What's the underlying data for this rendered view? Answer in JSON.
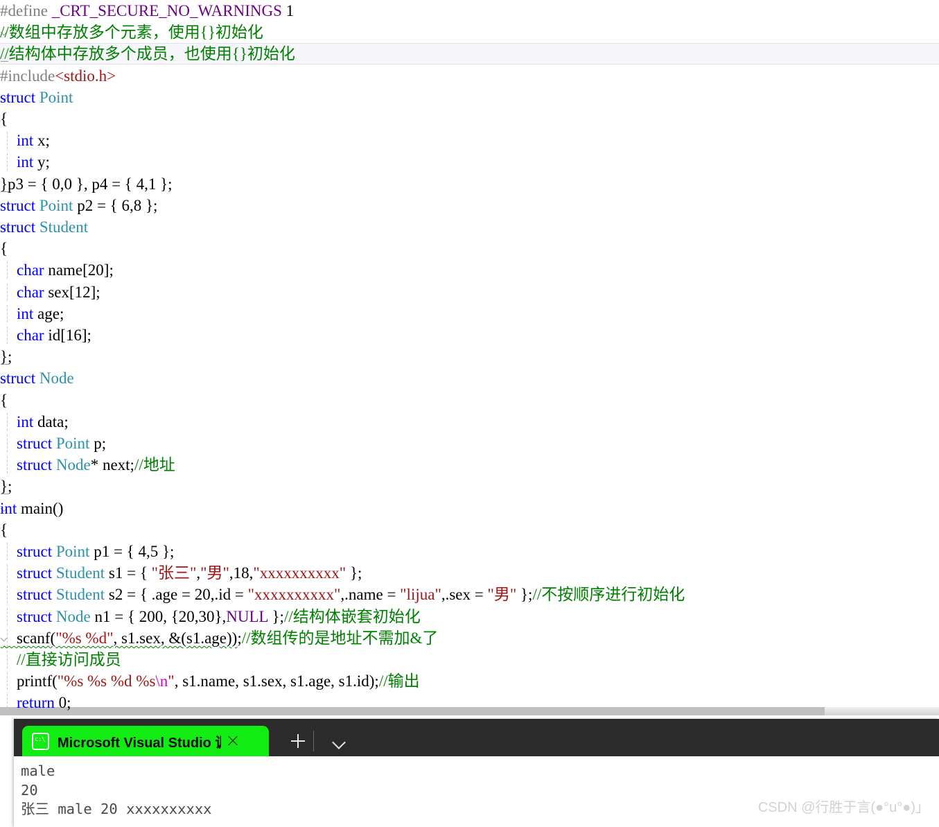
{
  "editor": {
    "lines": [
      {
        "id": "line-define",
        "indent": 0,
        "gutter": "none",
        "tokens": [
          {
            "t": "pp",
            "s": "#define "
          },
          {
            "t": "ppname",
            "s": "_CRT_SECURE_NO_WARNINGS"
          },
          {
            "t": "plain",
            "s": " 1"
          }
        ]
      },
      {
        "id": "line-comment-array",
        "indent": 0,
        "gutter": "arrow",
        "tokens": [
          {
            "t": "cmt",
            "s": "//数组中存放多个元素，使用{}初始化"
          }
        ]
      },
      {
        "id": "line-comment-struct",
        "indent": 0,
        "gutter": "end",
        "current": true,
        "tokens": [
          {
            "t": "cmt",
            "s": "//结构体中存放多个成员，也使用{}初始化"
          }
        ]
      },
      {
        "id": "line-include",
        "indent": 0,
        "gutter": "none",
        "tokens": [
          {
            "t": "pp",
            "s": "#include"
          },
          {
            "t": "hdr",
            "s": "<stdio.h>"
          }
        ]
      },
      {
        "id": "line-struct-point",
        "indent": 0,
        "gutter": "arrow",
        "tokens": [
          {
            "t": "kw",
            "s": "struct"
          },
          {
            "t": "plain",
            "s": " "
          },
          {
            "t": "type",
            "s": "Point"
          }
        ]
      },
      {
        "id": "line-point-open",
        "indent": 0,
        "gutter": "none",
        "tokens": [
          {
            "t": "plain",
            "s": "{"
          }
        ]
      },
      {
        "id": "line-point-x",
        "indent": 1,
        "gutter": "none",
        "guide": true,
        "tokens": [
          {
            "t": "plain",
            "s": "    "
          },
          {
            "t": "kw",
            "s": "int"
          },
          {
            "t": "plain",
            "s": " x;"
          }
        ]
      },
      {
        "id": "line-point-y",
        "indent": 1,
        "gutter": "none",
        "guide": true,
        "tokens": [
          {
            "t": "plain",
            "s": "    "
          },
          {
            "t": "kw",
            "s": "int"
          },
          {
            "t": "plain",
            "s": " y;"
          }
        ]
      },
      {
        "id": "line-point-close",
        "indent": 0,
        "gutter": "end",
        "tokens": [
          {
            "t": "plain",
            "s": "}p3 = { 0,0 }, p4 = { 4,1 };"
          }
        ]
      },
      {
        "id": "line-p2",
        "indent": 0,
        "gutter": "none",
        "tokens": [
          {
            "t": "kw",
            "s": "struct"
          },
          {
            "t": "plain",
            "s": " "
          },
          {
            "t": "type",
            "s": "Point"
          },
          {
            "t": "plain",
            "s": " p2 = { 6,8 };"
          }
        ]
      },
      {
        "id": "line-struct-student",
        "indent": 0,
        "gutter": "arrow",
        "tokens": [
          {
            "t": "kw",
            "s": "struct"
          },
          {
            "t": "plain",
            "s": " "
          },
          {
            "t": "type",
            "s": "Student"
          }
        ]
      },
      {
        "id": "line-student-open",
        "indent": 0,
        "gutter": "none",
        "tokens": [
          {
            "t": "plain",
            "s": "{"
          }
        ]
      },
      {
        "id": "line-student-name",
        "indent": 1,
        "gutter": "none",
        "guide": true,
        "tokens": [
          {
            "t": "plain",
            "s": "    "
          },
          {
            "t": "kw",
            "s": "char"
          },
          {
            "t": "plain",
            "s": " name[20];"
          }
        ]
      },
      {
        "id": "line-student-sex",
        "indent": 1,
        "gutter": "none",
        "guide": true,
        "tokens": [
          {
            "t": "plain",
            "s": "    "
          },
          {
            "t": "kw",
            "s": "char"
          },
          {
            "t": "plain",
            "s": " sex[12];"
          }
        ]
      },
      {
        "id": "line-student-age",
        "indent": 1,
        "gutter": "none",
        "guide": true,
        "tokens": [
          {
            "t": "plain",
            "s": "    "
          },
          {
            "t": "kw",
            "s": "int"
          },
          {
            "t": "plain",
            "s": " age;"
          }
        ]
      },
      {
        "id": "line-student-id",
        "indent": 1,
        "gutter": "none",
        "guide": true,
        "tokens": [
          {
            "t": "plain",
            "s": "    "
          },
          {
            "t": "kw",
            "s": "char"
          },
          {
            "t": "plain",
            "s": " id[16];"
          }
        ]
      },
      {
        "id": "line-student-close",
        "indent": 0,
        "gutter": "end",
        "tokens": [
          {
            "t": "plain",
            "s": "};"
          }
        ]
      },
      {
        "id": "line-struct-node",
        "indent": 0,
        "gutter": "arrow",
        "tokens": [
          {
            "t": "kw",
            "s": "struct"
          },
          {
            "t": "plain",
            "s": " "
          },
          {
            "t": "type",
            "s": "Node"
          }
        ]
      },
      {
        "id": "line-node-open",
        "indent": 0,
        "gutter": "none",
        "tokens": [
          {
            "t": "plain",
            "s": "{"
          }
        ]
      },
      {
        "id": "line-node-data",
        "indent": 1,
        "gutter": "none",
        "guide": true,
        "tokens": [
          {
            "t": "plain",
            "s": "    "
          },
          {
            "t": "kw",
            "s": "int"
          },
          {
            "t": "plain",
            "s": " data;"
          }
        ]
      },
      {
        "id": "line-node-p",
        "indent": 1,
        "gutter": "none",
        "guide": true,
        "tokens": [
          {
            "t": "plain",
            "s": "    "
          },
          {
            "t": "kw",
            "s": "struct"
          },
          {
            "t": "plain",
            "s": " "
          },
          {
            "t": "type",
            "s": "Point"
          },
          {
            "t": "plain",
            "s": " p;"
          }
        ]
      },
      {
        "id": "line-node-next",
        "indent": 1,
        "gutter": "none",
        "guide": true,
        "tokens": [
          {
            "t": "plain",
            "s": "    "
          },
          {
            "t": "kw",
            "s": "struct"
          },
          {
            "t": "plain",
            "s": " "
          },
          {
            "t": "type",
            "s": "Node"
          },
          {
            "t": "plain",
            "s": "* next;"
          },
          {
            "t": "cmt",
            "s": "//地址"
          }
        ]
      },
      {
        "id": "line-node-close",
        "indent": 0,
        "gutter": "end",
        "tokens": [
          {
            "t": "plain",
            "s": "};"
          }
        ]
      },
      {
        "id": "line-main",
        "indent": 0,
        "gutter": "arrow",
        "tokens": [
          {
            "t": "kw",
            "s": "int"
          },
          {
            "t": "plain",
            "s": " "
          },
          {
            "t": "fn",
            "s": "main"
          },
          {
            "t": "plain",
            "s": "()"
          }
        ]
      },
      {
        "id": "line-main-open",
        "indent": 0,
        "gutter": "none",
        "tokens": [
          {
            "t": "plain",
            "s": "{"
          }
        ]
      },
      {
        "id": "line-p1",
        "indent": 1,
        "gutter": "none",
        "guide": true,
        "tokens": [
          {
            "t": "plain",
            "s": "    "
          },
          {
            "t": "kw",
            "s": "struct"
          },
          {
            "t": "plain",
            "s": " "
          },
          {
            "t": "type",
            "s": "Point"
          },
          {
            "t": "plain",
            "s": " p1 = { 4,5 };"
          }
        ]
      },
      {
        "id": "line-s1",
        "indent": 1,
        "gutter": "none",
        "guide": true,
        "tokens": [
          {
            "t": "plain",
            "s": "    "
          },
          {
            "t": "kw",
            "s": "struct"
          },
          {
            "t": "plain",
            "s": " "
          },
          {
            "t": "type",
            "s": "Student"
          },
          {
            "t": "plain",
            "s": " s1 = { "
          },
          {
            "t": "str",
            "s": "\"张三\""
          },
          {
            "t": "plain",
            "s": ","
          },
          {
            "t": "str",
            "s": "\"男\""
          },
          {
            "t": "plain",
            "s": ",18,"
          },
          {
            "t": "str",
            "s": "\"xxxxxxxxxx\""
          },
          {
            "t": "plain",
            "s": " };"
          }
        ]
      },
      {
        "id": "line-s2",
        "indent": 1,
        "gutter": "none",
        "guide": true,
        "tokens": [
          {
            "t": "plain",
            "s": "    "
          },
          {
            "t": "kw",
            "s": "struct"
          },
          {
            "t": "plain",
            "s": " "
          },
          {
            "t": "type",
            "s": "Student"
          },
          {
            "t": "plain",
            "s": " s2 = { .age = 20,.id = "
          },
          {
            "t": "str",
            "s": "\"xxxxxxxxxx\""
          },
          {
            "t": "plain",
            "s": ",.name = "
          },
          {
            "t": "str",
            "s": "\"lijua\""
          },
          {
            "t": "plain",
            "s": ",.sex = "
          },
          {
            "t": "str",
            "s": "\"男\""
          },
          {
            "t": "plain",
            "s": " };"
          },
          {
            "t": "cmt",
            "s": "//不按顺序进行初始化"
          }
        ]
      },
      {
        "id": "line-n1",
        "indent": 1,
        "gutter": "none",
        "guide": true,
        "tokens": [
          {
            "t": "plain",
            "s": "    "
          },
          {
            "t": "kw",
            "s": "struct"
          },
          {
            "t": "plain",
            "s": " "
          },
          {
            "t": "type",
            "s": "Node"
          },
          {
            "t": "plain",
            "s": " n1 = { 200, {20,30},"
          },
          {
            "t": "macro",
            "s": "NULL"
          },
          {
            "t": "plain",
            "s": " };"
          },
          {
            "t": "cmt",
            "s": "//结构体嵌套初始化"
          }
        ]
      },
      {
        "id": "line-scanf",
        "indent": 1,
        "gutter": "arrow",
        "guide": true,
        "tokens": [
          {
            "t": "plain squiggle",
            "s": "    scanf("
          },
          {
            "t": "str squiggle",
            "s": "\"%s %d\""
          },
          {
            "t": "plain squiggle",
            "s": ", s1.sex, &(s1.age))"
          },
          {
            "t": "plain",
            "s": ";"
          },
          {
            "t": "cmt",
            "s": "//数组传的是地址不需加&了"
          }
        ]
      },
      {
        "id": "line-comment-access",
        "indent": 1,
        "gutter": "none",
        "guide": true,
        "tokens": [
          {
            "t": "plain",
            "s": "    "
          },
          {
            "t": "cmt",
            "s": "//直接访问成员"
          }
        ]
      },
      {
        "id": "line-printf",
        "indent": 1,
        "gutter": "none",
        "guide": true,
        "tokens": [
          {
            "t": "plain",
            "s": "    printf("
          },
          {
            "t": "str",
            "s": "\"%s %s %d %s"
          },
          {
            "t": "esc",
            "s": "\\n"
          },
          {
            "t": "str",
            "s": "\""
          },
          {
            "t": "plain",
            "s": ", s1.name, s1.sex, s1.age, s1.id);"
          },
          {
            "t": "cmt",
            "s": "//输出"
          }
        ]
      },
      {
        "id": "line-return",
        "indent": 1,
        "gutter": "none",
        "guide": true,
        "tokens": [
          {
            "t": "plain",
            "s": "    "
          },
          {
            "t": "kw",
            "s": "return"
          },
          {
            "t": "plain",
            "s": " 0;"
          }
        ]
      },
      {
        "id": "line-main-close",
        "indent": 0,
        "gutter": "end",
        "tokens": [
          {
            "t": "plain",
            "s": "}"
          }
        ]
      }
    ],
    "colors": {
      "keyword": "#0000ff",
      "type": "#2b91af",
      "comment": "#008000",
      "string": "#a31515",
      "preprocessor": "#808080",
      "macro": "#6f008a",
      "current_line_bg": "#f7f7fb",
      "background": "#ffffff"
    }
  },
  "console": {
    "tab": {
      "title": "Microsoft Visual Studio 调试控",
      "icon": "console-prompt-icon",
      "close_icon": "close-icon",
      "active_color": "#12ec12"
    },
    "toolbar": {
      "new_tab_icon": "plus-icon",
      "dropdown_icon": "chevron-down-icon"
    },
    "titlebar_color": "#2b2b2b",
    "output": [
      "male",
      "20",
      "张三 male 20 xxxxxxxxxx"
    ]
  },
  "watermark": {
    "text": "CSDN @行胜于言(●°u°●)」"
  }
}
